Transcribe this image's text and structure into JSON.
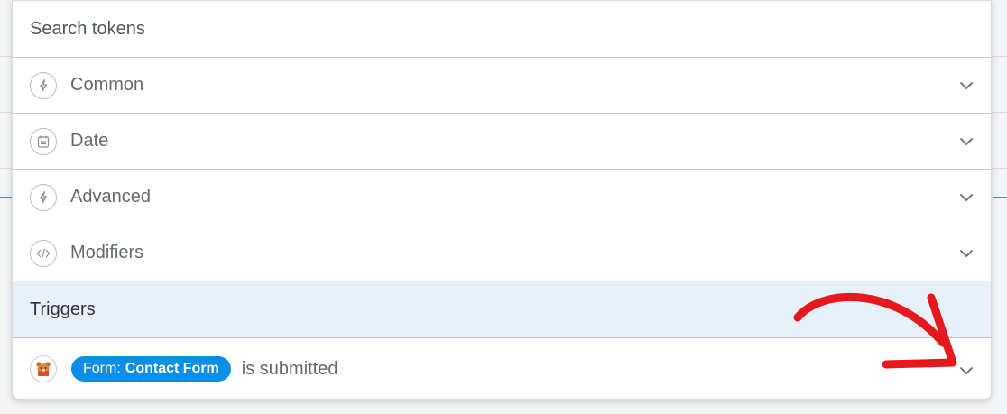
{
  "search": {
    "placeholder": "Search tokens"
  },
  "categories": [
    {
      "label": "Common",
      "icon": "bolt-icon"
    },
    {
      "label": "Date",
      "icon": "calendar-icon"
    },
    {
      "label": "Advanced",
      "icon": "bolt-icon"
    },
    {
      "label": "Modifiers",
      "icon": "code-icon"
    }
  ],
  "triggers": {
    "heading": "Triggers",
    "items": [
      {
        "icon": "wpforms-bear-icon",
        "pill_prefix": "Form:",
        "pill_name": "Contact Form",
        "suffix": "is submitted"
      }
    ]
  },
  "colors": {
    "pill": "#0b8fe6",
    "triggers_bg": "#e8f0fa",
    "annotation_arrow": "#e8171b"
  }
}
